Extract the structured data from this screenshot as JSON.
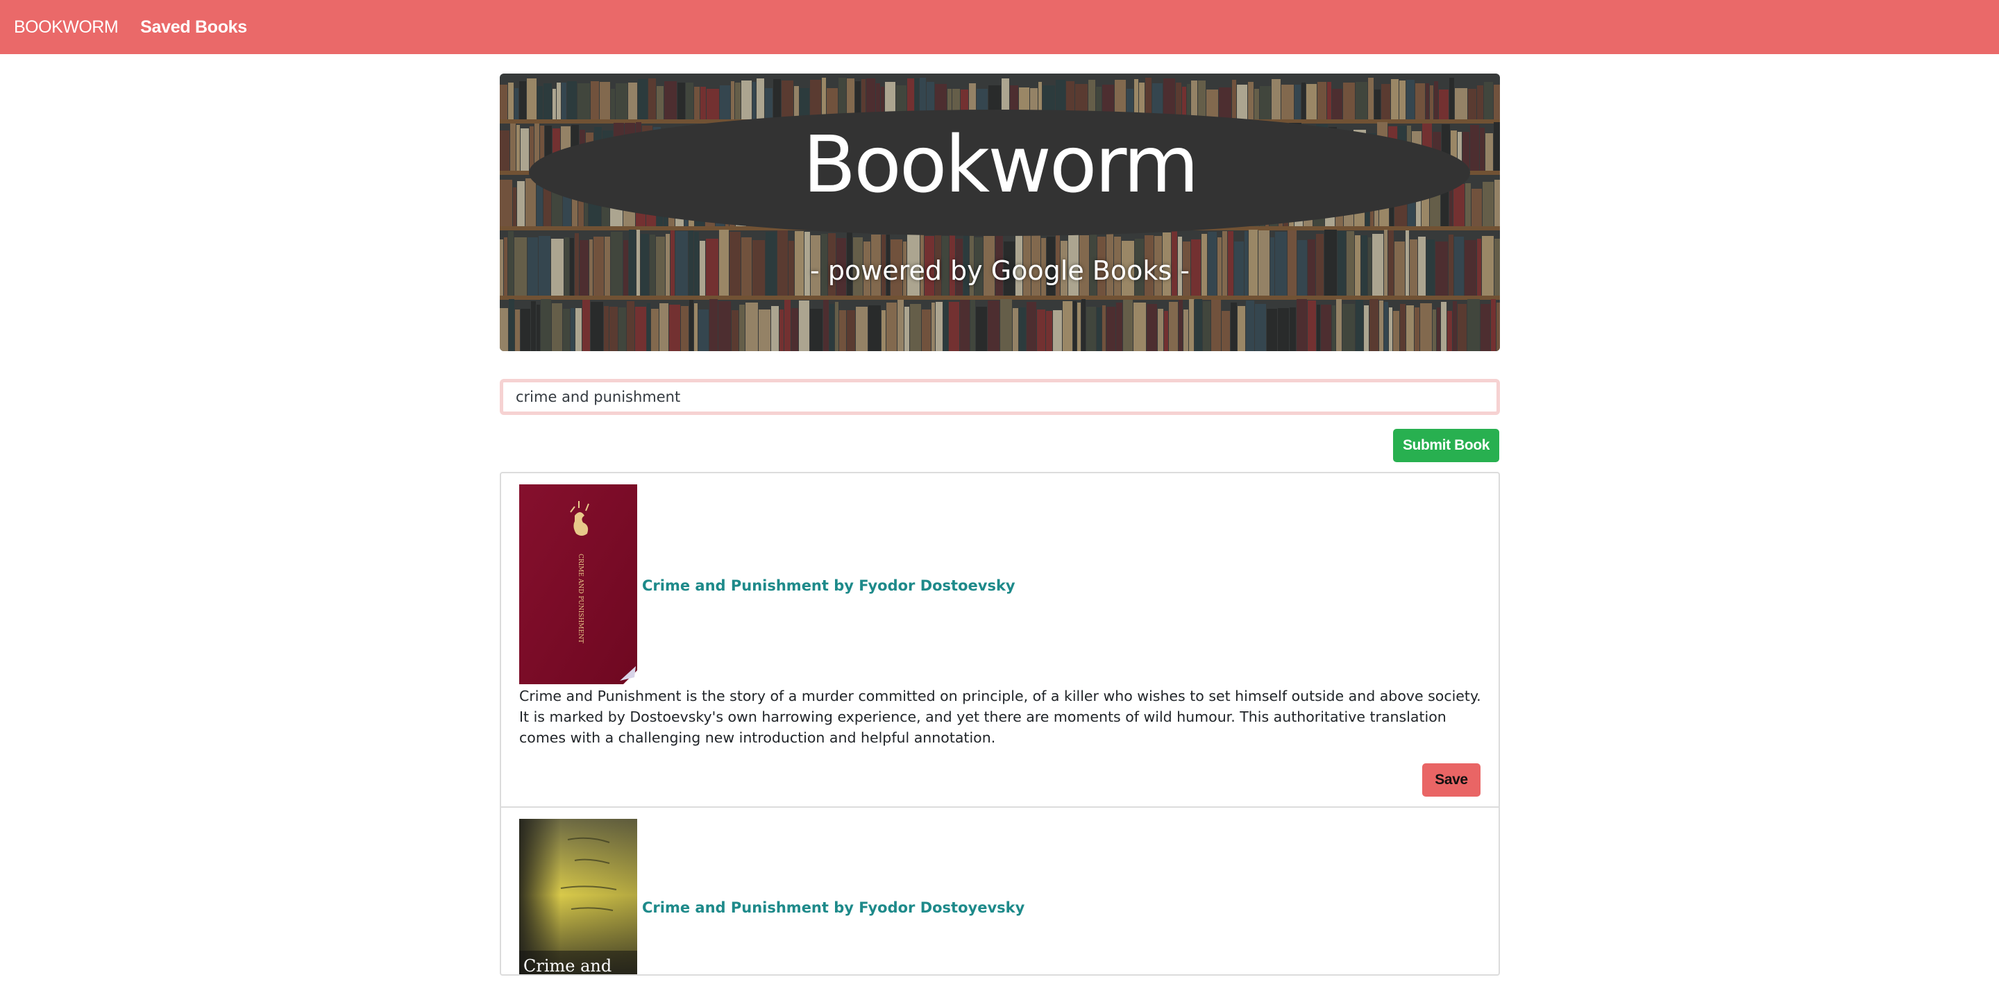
{
  "navbar": {
    "brand": "BOOKWORM",
    "saved_link": "Saved Books"
  },
  "hero": {
    "title": "Bookworm",
    "subtitle": "- powered by Google Books -"
  },
  "search": {
    "value": "crime and punishment",
    "submit_label": "Submit Book"
  },
  "results": [
    {
      "title": "Crime and Punishment by Fyodor Dostoevsky",
      "description": "Crime and Punishment is the story of a murder committed on principle, of a killer who wishes to set himself outside and above society. It is marked by Dostoevsky's own harrowing experience, and yet there are moments of wild humour. This authoritative translation comes with a challenging new introduction and helpful annotation.",
      "save_label": "Save",
      "cover_text": "CRIME AND PUNISHMENT"
    },
    {
      "title": "Crime and Punishment by Fyodor Dostoyevsky",
      "cover_text": "Crime and Punishment"
    }
  ],
  "colors": {
    "navbar": "#ea6969",
    "submit": "#28b050",
    "save": "#e96565",
    "link": "#1e8a8a"
  }
}
